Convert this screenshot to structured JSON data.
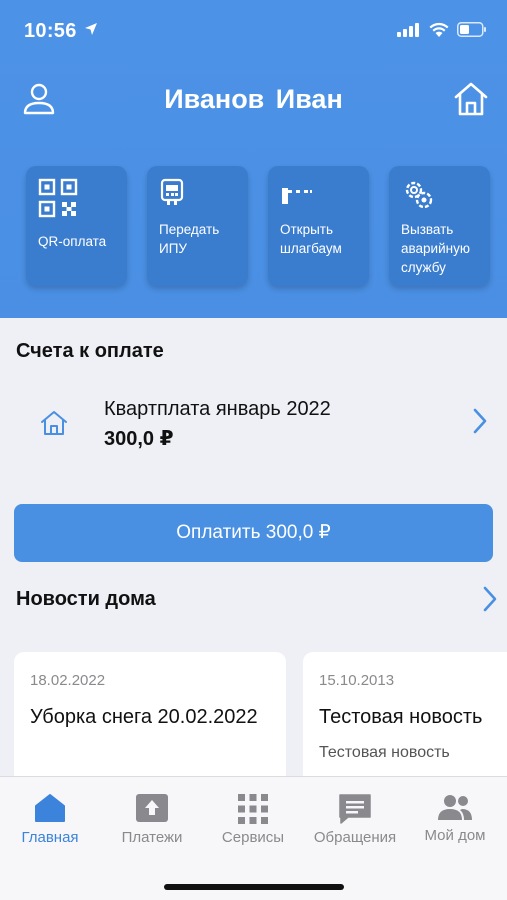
{
  "status_bar": {
    "time": "10:56"
  },
  "header": {
    "user_name": "Иванов  Иван",
    "actions": [
      {
        "label": "QR-оплата",
        "icon": "qr-code-icon"
      },
      {
        "label": "Передать ИПУ",
        "icon": "meter-icon"
      },
      {
        "label": "Открыть шлагбаум",
        "icon": "barrier-icon"
      },
      {
        "label": "Вызвать аварийную службу",
        "icon": "emergency-gear-icon"
      }
    ]
  },
  "bills": {
    "title": "Счета к оплате",
    "items": [
      {
        "name": "Квартплата январь 2022",
        "amount": "300,0 ₽",
        "icon": "home-icon"
      }
    ],
    "pay_label": "Оплатить 300,0 ₽"
  },
  "news": {
    "title": "Новости дома",
    "items": [
      {
        "date": "18.02.2022",
        "title": "Уборка снега 20.02.2022",
        "text": ""
      },
      {
        "date": "15.10.2013",
        "title": "Тестовая новость",
        "text": "Тестовая новость"
      }
    ]
  },
  "tabs": [
    {
      "label": "Главная",
      "icon": "home-icon",
      "active": true
    },
    {
      "label": "Платежи",
      "icon": "upload-box-icon",
      "active": false
    },
    {
      "label": "Сервисы",
      "icon": "grid-icon",
      "active": false
    },
    {
      "label": "Обращения",
      "icon": "chat-icon",
      "active": false
    },
    {
      "label": "Мой дом",
      "icon": "people-icon",
      "active": false
    }
  ],
  "colors": {
    "header": "#4a90e2",
    "action_card": "#3a7dcf",
    "accent": "#3c83dc",
    "background": "#eef0f5"
  }
}
